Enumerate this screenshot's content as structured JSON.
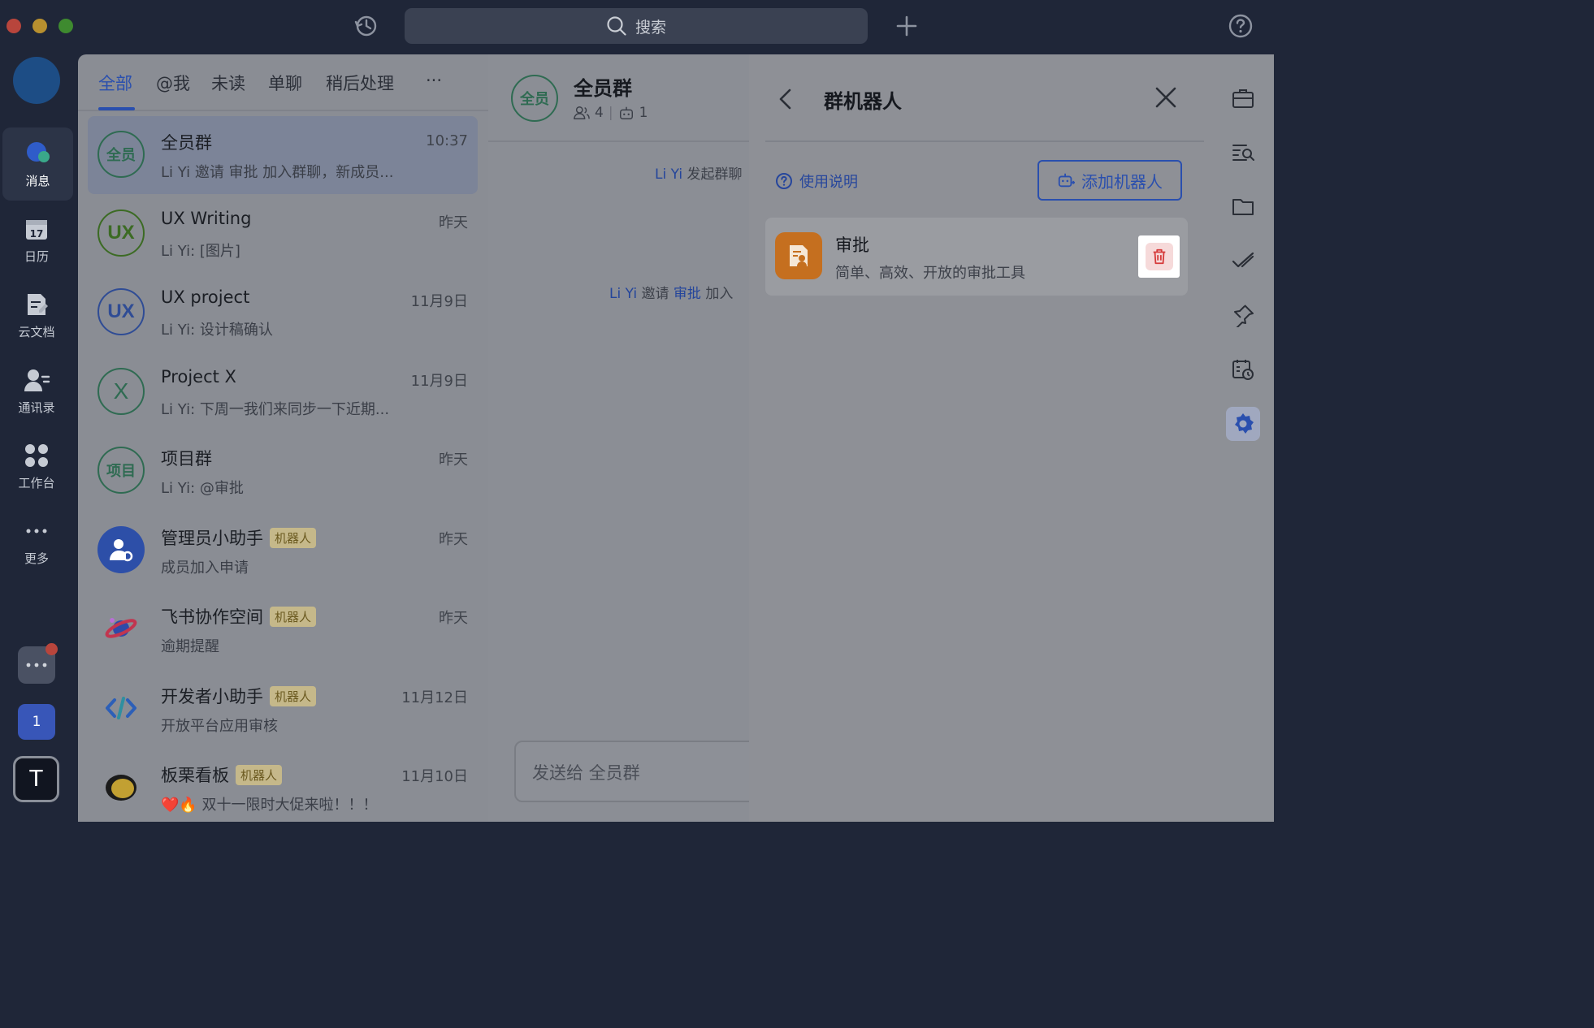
{
  "titlebar": {
    "search_placeholder": "搜索",
    "traffic_colors": [
      "#b8453c",
      "#b8902f",
      "#3e8a2f"
    ]
  },
  "rail": {
    "items": [
      {
        "label": "消息",
        "icon": "message-icon"
      },
      {
        "label": "日历",
        "icon": "calendar-icon",
        "date": "17"
      },
      {
        "label": "云文档",
        "icon": "docs-icon"
      },
      {
        "label": "通讯录",
        "icon": "contacts-icon"
      },
      {
        "label": "工作台",
        "icon": "workplace-icon"
      },
      {
        "label": "更多",
        "icon": "more-icon"
      }
    ],
    "badge_number": "1",
    "user_initial": "T"
  },
  "chat_list": {
    "tabs": [
      "全部",
      "@我",
      "未读",
      "单聊",
      "稍后处理",
      "···"
    ],
    "bot_badge": "机器人",
    "chats": [
      {
        "avatar": "全员",
        "name": "全员群",
        "preview": "Li Yi 邀请 审批 加入群聊，新成员...",
        "time": "10:37",
        "bot": false
      },
      {
        "avatar": "UX",
        "name": "UX Writing",
        "preview": "Li Yi: [图片]",
        "time": "昨天",
        "bot": false
      },
      {
        "avatar": "UX",
        "name": "UX project",
        "preview": "Li Yi: 设计稿确认",
        "time": "11月9日",
        "bot": false
      },
      {
        "avatar": "X",
        "name": "Project X",
        "preview": "Li Yi: 下周一我们来同步一下近期...",
        "time": "11月9日",
        "bot": false
      },
      {
        "avatar": "项目",
        "name": "项目群",
        "preview": "Li Yi: @审批",
        "time": "昨天",
        "bot": false
      },
      {
        "avatar": "",
        "name": "管理员小助手",
        "preview": "成员加入申请",
        "time": "昨天",
        "bot": true
      },
      {
        "avatar": "",
        "name": "飞书协作空间",
        "preview": "逾期提醒",
        "time": "昨天",
        "bot": true
      },
      {
        "avatar": "",
        "name": "开发者小助手",
        "preview": "开放平台应用审核",
        "time": "11月12日",
        "bot": true
      },
      {
        "avatar": "",
        "name": "板栗看板",
        "preview": "❤️🔥 双十一限时大促来啦！！！",
        "time": "11月10日",
        "bot": true
      }
    ]
  },
  "conversation": {
    "avatar": "全员",
    "title": "全员群",
    "members": "4",
    "bots": "1",
    "msg1_user": "Li Yi",
    "msg1_text": "发起群聊",
    "msg2_user": "Li Yi",
    "msg2_text1": "邀请",
    "msg2_bot": "审批",
    "msg2_text2": "加入",
    "composer_placeholder": "发送给 全员群"
  },
  "bot_panel": {
    "title": "群机器人",
    "help_label": "使用说明",
    "add_label": "添加机器人",
    "bot": {
      "name": "审批",
      "description": "简单、高效、开放的审批工具"
    }
  }
}
